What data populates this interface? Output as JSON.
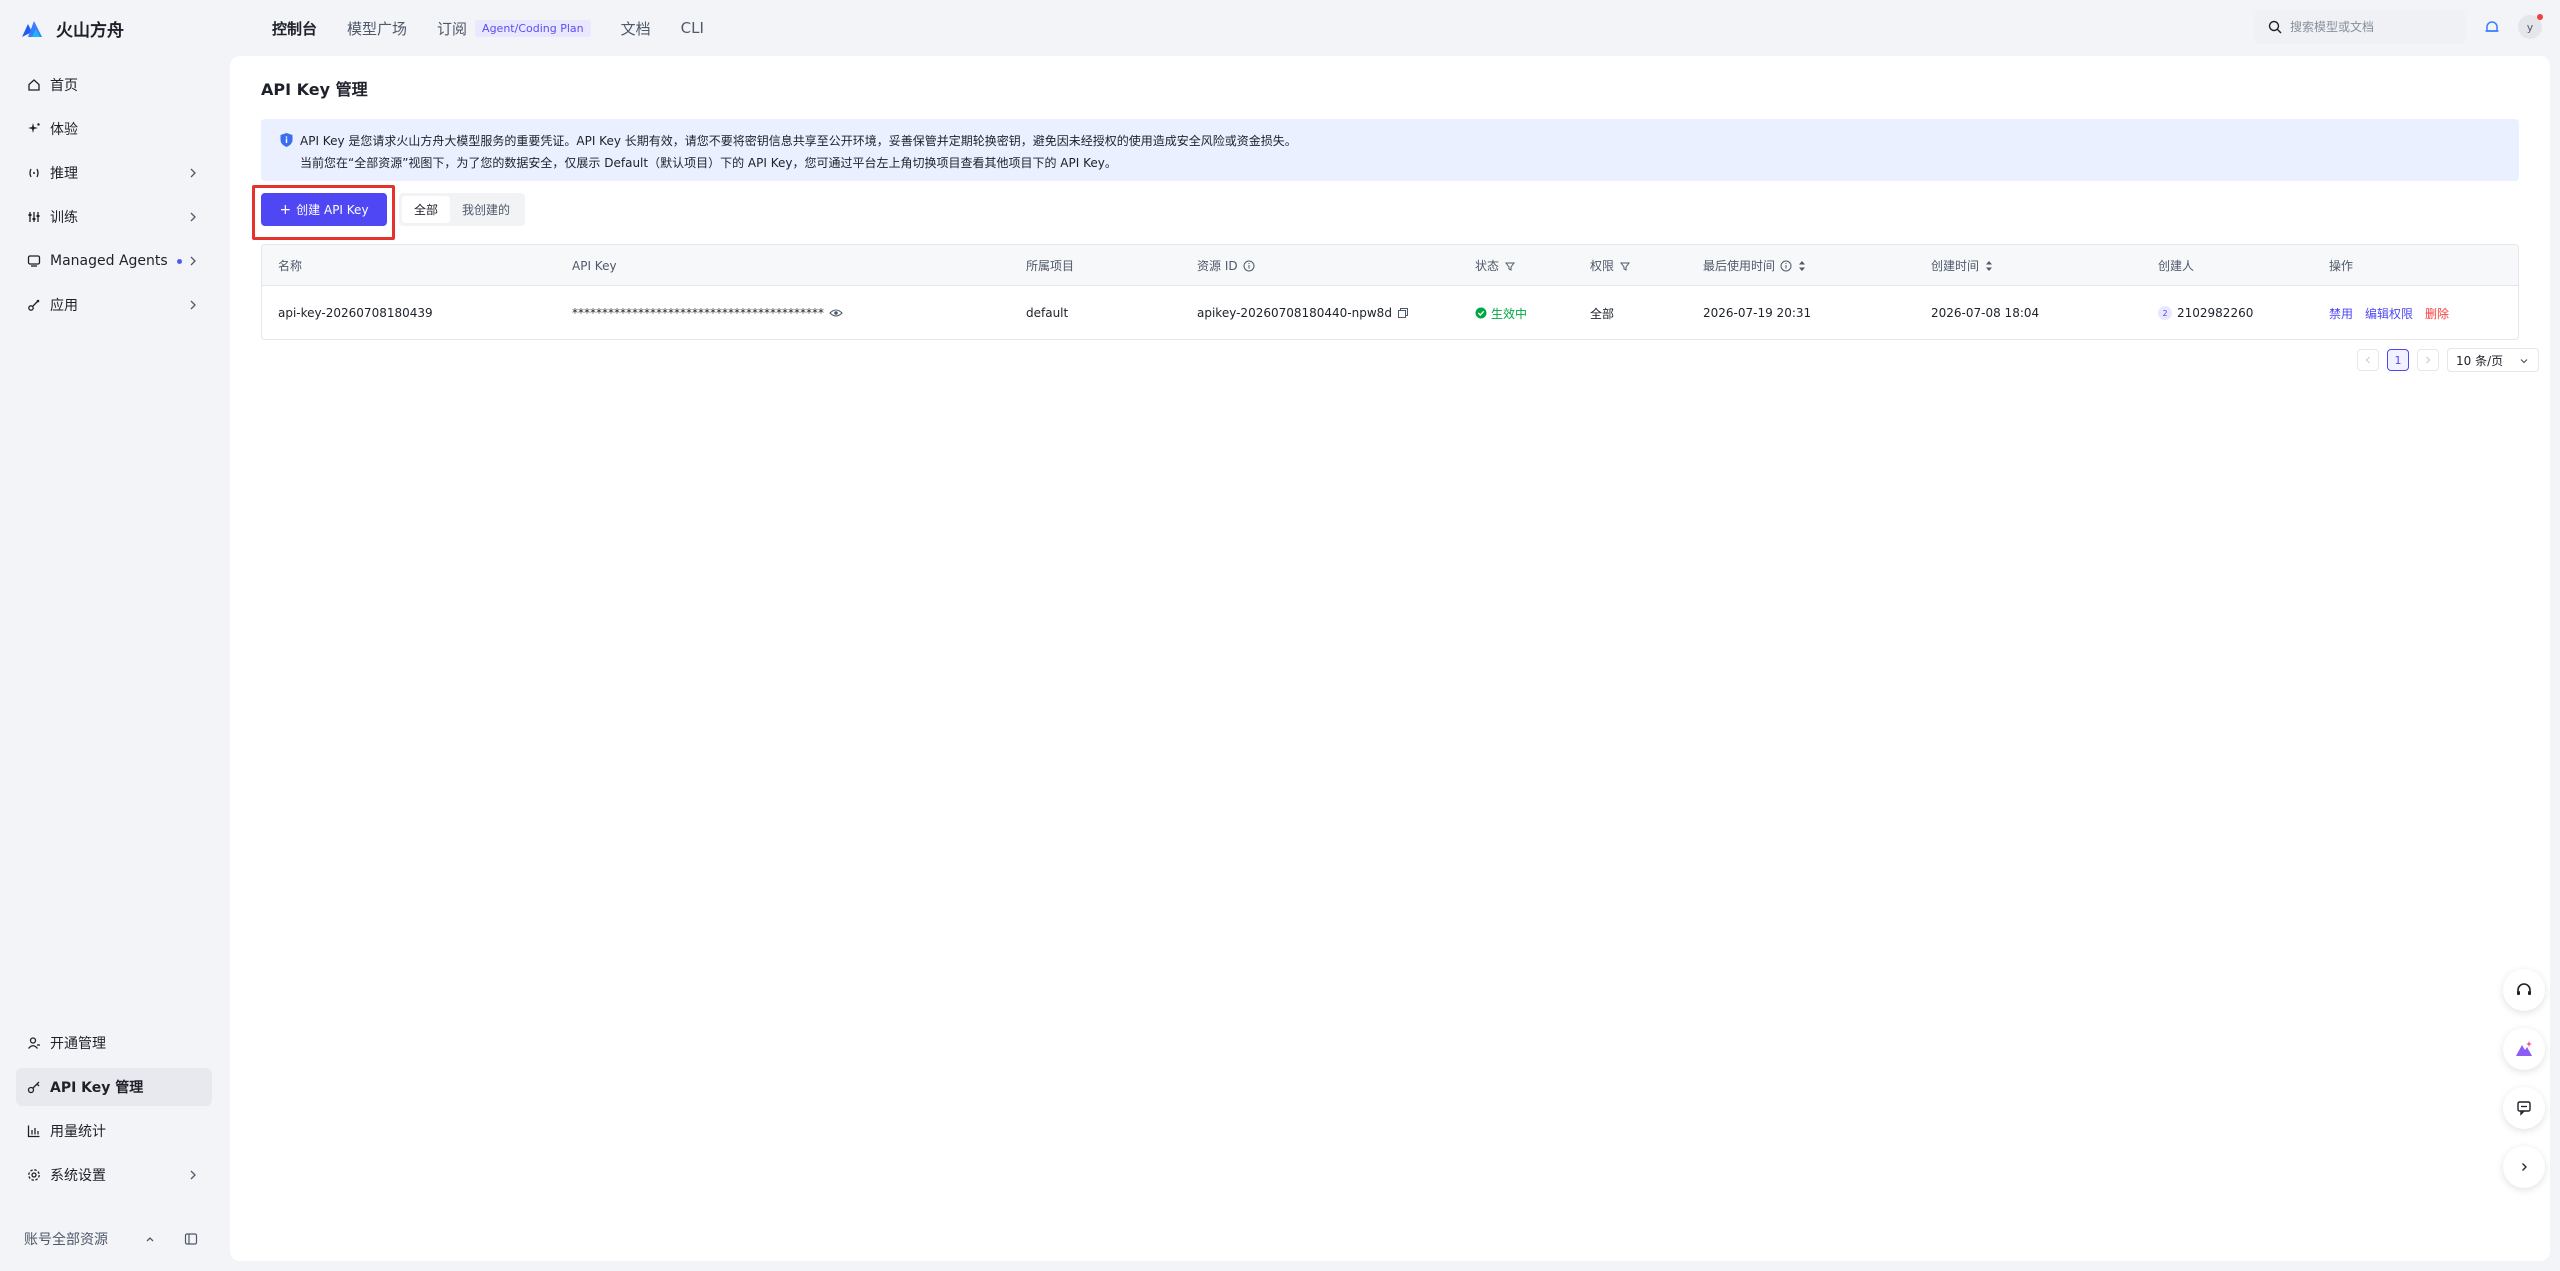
{
  "app": {
    "name": "火山方舟"
  },
  "topnav": {
    "items": [
      {
        "label": "控制台"
      },
      {
        "label": "模型广场"
      },
      {
        "label": "订阅",
        "badge": "Agent/Coding Plan"
      },
      {
        "label": "文档"
      },
      {
        "label": "CLI"
      }
    ]
  },
  "search": {
    "placeholder": "搜索模型或文档",
    "value": ""
  },
  "user": {
    "avatar_letter": "y"
  },
  "sidebar": {
    "items": [
      {
        "label": "首页",
        "icon": "home-icon"
      },
      {
        "label": "体验",
        "icon": "sparkle-icon"
      },
      {
        "label": "推理",
        "icon": "inference-icon"
      },
      {
        "label": "训练",
        "icon": "train-icon"
      },
      {
        "label": "Managed Agents",
        "icon": "agent-icon"
      },
      {
        "label": "应用",
        "icon": "app-icon"
      }
    ],
    "bottom_items": [
      {
        "label": "开通管理",
        "icon": "user-manage-icon"
      },
      {
        "label": "API Key 管理",
        "icon": "key-icon",
        "active": true
      },
      {
        "label": "用量统计",
        "icon": "chart-icon"
      },
      {
        "label": "系统设置",
        "icon": "settings-icon"
      }
    ],
    "footer_label": "账号全部资源"
  },
  "page": {
    "title": "API Key 管理",
    "info_line1": "API Key 是您请求火山方舟大模型服务的重要凭证。API Key 长期有效，请您不要将密钥信息共享至公开环境，妥善保管并定期轮换密钥，避免因未经授权的使用造成安全风险或资金损失。",
    "info_line2": "当前您在“全部资源”视图下，为了您的数据安全，仅展示 Default（默认项目）下的 API Key，您可通过平台左上角切换项目查看其他项目下的 API Key。",
    "create_button": "创建 API Key",
    "filter_tabs": [
      "全部",
      "我创建的"
    ]
  },
  "table": {
    "columns": [
      "名称",
      "API Key",
      "所属项目",
      "资源 ID",
      "状态",
      "权限",
      "最后使用时间",
      "创建时间",
      "创建人",
      "操作"
    ],
    "rows": [
      {
        "name": "api-key-20260708180439",
        "api_key": "******************************************",
        "project": "default",
        "resource_id": "apikey-20260708180440-npw8d",
        "status": "生效中",
        "permission": "全部",
        "last_used": "2026-07-19 20:31",
        "created": "2026-07-08 18:04",
        "creator_badge": "2",
        "creator": "2102982260",
        "actions": [
          "禁用",
          "编辑权限",
          "删除"
        ]
      }
    ]
  },
  "pagination": {
    "current_page": "1",
    "page_size": "10 条/页"
  },
  "colors": {
    "accent": "#4f47f3",
    "success": "#00a744",
    "danger": "#f53f3f",
    "highlight_border": "#e5322d"
  }
}
